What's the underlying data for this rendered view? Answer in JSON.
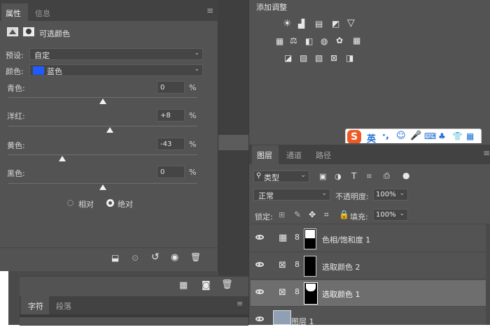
{
  "props_panel": {
    "tabs": [
      "属性",
      "信息"
    ],
    "title": "可选颜色",
    "preset_label": "预设:",
    "preset_value": "自定",
    "color_label": "颜色:",
    "color_value": "蓝色",
    "color_swatch": "#1f5bff",
    "sliders": [
      {
        "label": "青色:",
        "value": "0",
        "unit": "%",
        "level": 0
      },
      {
        "label": "洋红:",
        "value": "+8",
        "unit": "%",
        "level": 8
      },
      {
        "label": "黄色:",
        "value": "-43",
        "unit": "%",
        "level": -43
      },
      {
        "label": "黑色:",
        "value": "0",
        "unit": "%",
        "level": 0
      }
    ],
    "method_relative": "相对",
    "method_absolute": "绝对",
    "method_selected": "absolute"
  },
  "adjust_panel": {
    "title": "添加调整"
  },
  "ime_bar": {
    "logo": "S",
    "lang": "英",
    "punct": "·,"
  },
  "layers_panel": {
    "tabs": [
      "图层",
      "通道",
      "路径"
    ],
    "filter_label": "类型",
    "blend_mode": "正常",
    "opacity_label": "不透明度:",
    "opacity_value": "100%",
    "lock_label": "锁定:",
    "fill_label": "填充:",
    "fill_value": "100%",
    "layers": [
      {
        "name": "色相/饱和度 1",
        "type": "hue-saturation",
        "selected": false
      },
      {
        "name": "选取颜色 2",
        "type": "selective-color",
        "selected": false
      },
      {
        "name": "选取颜色 1",
        "type": "selective-color",
        "selected": true
      },
      {
        "name": "图层 1",
        "type": "pixel",
        "selected": false
      }
    ]
  },
  "char_panel": {
    "tabs": [
      "字符",
      "段落"
    ]
  }
}
